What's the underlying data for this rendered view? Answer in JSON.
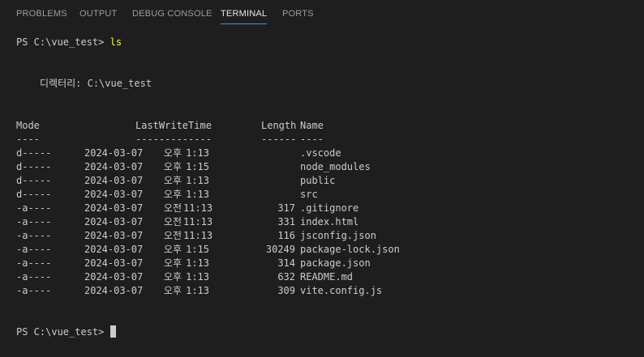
{
  "tabs": [
    {
      "label": "PROBLEMS"
    },
    {
      "label": "OUTPUT"
    },
    {
      "label": "DEBUG CONSOLE"
    },
    {
      "label": "TERMINAL",
      "active": true
    },
    {
      "label": "PORTS"
    }
  ],
  "terminal": {
    "prompt": "PS C:\\vue_test> ",
    "command": "ls",
    "directory_label": "디렉터리: C:\\vue_test",
    "headers": {
      "mode": "Mode",
      "time": "LastWriteTime",
      "length": "Length",
      "name": "Name"
    },
    "underlines": {
      "mode": "----",
      "time": "-------------",
      "length": "------",
      "name": "----"
    },
    "rows": [
      {
        "mode": "d-----",
        "date": "2024-03-07",
        "ampm": "오후",
        "clock": "1:13",
        "length": "",
        "name": ".vscode"
      },
      {
        "mode": "d-----",
        "date": "2024-03-07",
        "ampm": "오후",
        "clock": "1:15",
        "length": "",
        "name": "node_modules"
      },
      {
        "mode": "d-----",
        "date": "2024-03-07",
        "ampm": "오후",
        "clock": "1:13",
        "length": "",
        "name": "public"
      },
      {
        "mode": "d-----",
        "date": "2024-03-07",
        "ampm": "오후",
        "clock": "1:13",
        "length": "",
        "name": "src"
      },
      {
        "mode": "-a----",
        "date": "2024-03-07",
        "ampm": "오전",
        "clock": "11:13",
        "length": "317",
        "name": ".gitignore"
      },
      {
        "mode": "-a----",
        "date": "2024-03-07",
        "ampm": "오전",
        "clock": "11:13",
        "length": "331",
        "name": "index.html"
      },
      {
        "mode": "-a----",
        "date": "2024-03-07",
        "ampm": "오전",
        "clock": "11:13",
        "length": "116",
        "name": "jsconfig.json"
      },
      {
        "mode": "-a----",
        "date": "2024-03-07",
        "ampm": "오후",
        "clock": "1:15",
        "length": "30249",
        "name": "package-lock.json"
      },
      {
        "mode": "-a----",
        "date": "2024-03-07",
        "ampm": "오후",
        "clock": "1:13",
        "length": "314",
        "name": "package.json"
      },
      {
        "mode": "-a----",
        "date": "2024-03-07",
        "ampm": "오후",
        "clock": "1:13",
        "length": "632",
        "name": "README.md"
      },
      {
        "mode": "-a----",
        "date": "2024-03-07",
        "ampm": "오후",
        "clock": "1:13",
        "length": "309",
        "name": "vite.config.js"
      }
    ],
    "final_prompt": "PS C:\\vue_test> "
  },
  "colors": {
    "background": "#1e1e1e",
    "text": "#cccccc",
    "command": "#f5f543",
    "active_tab_underline": "#3794ff"
  }
}
